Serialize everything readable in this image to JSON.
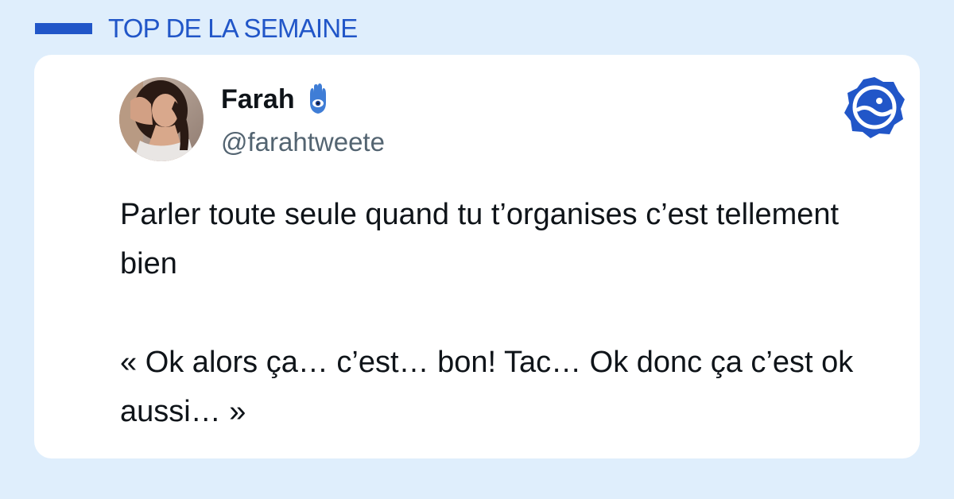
{
  "header": {
    "title": "TOP DE LA SEMAINE",
    "accent_color": "#2156c8"
  },
  "tweet": {
    "author": {
      "name": "Farah",
      "name_emoji_icon": "hamsa-icon",
      "handle": "@farahtweete",
      "avatar_icon": "avatar-photo"
    },
    "paragraphs": [
      "Parler toute seule quand tu t’organises c’est tellement bien",
      "« Ok alors ça… c’est… bon! Tac… Ok donc ça c’est ok aussi… »"
    ]
  },
  "brand": {
    "icon": "brand-logo-icon",
    "color": "#2156c8"
  },
  "colors": {
    "background": "#dfeefc",
    "card": "#ffffff",
    "text": "#0f1419",
    "secondary_text": "#536471"
  }
}
